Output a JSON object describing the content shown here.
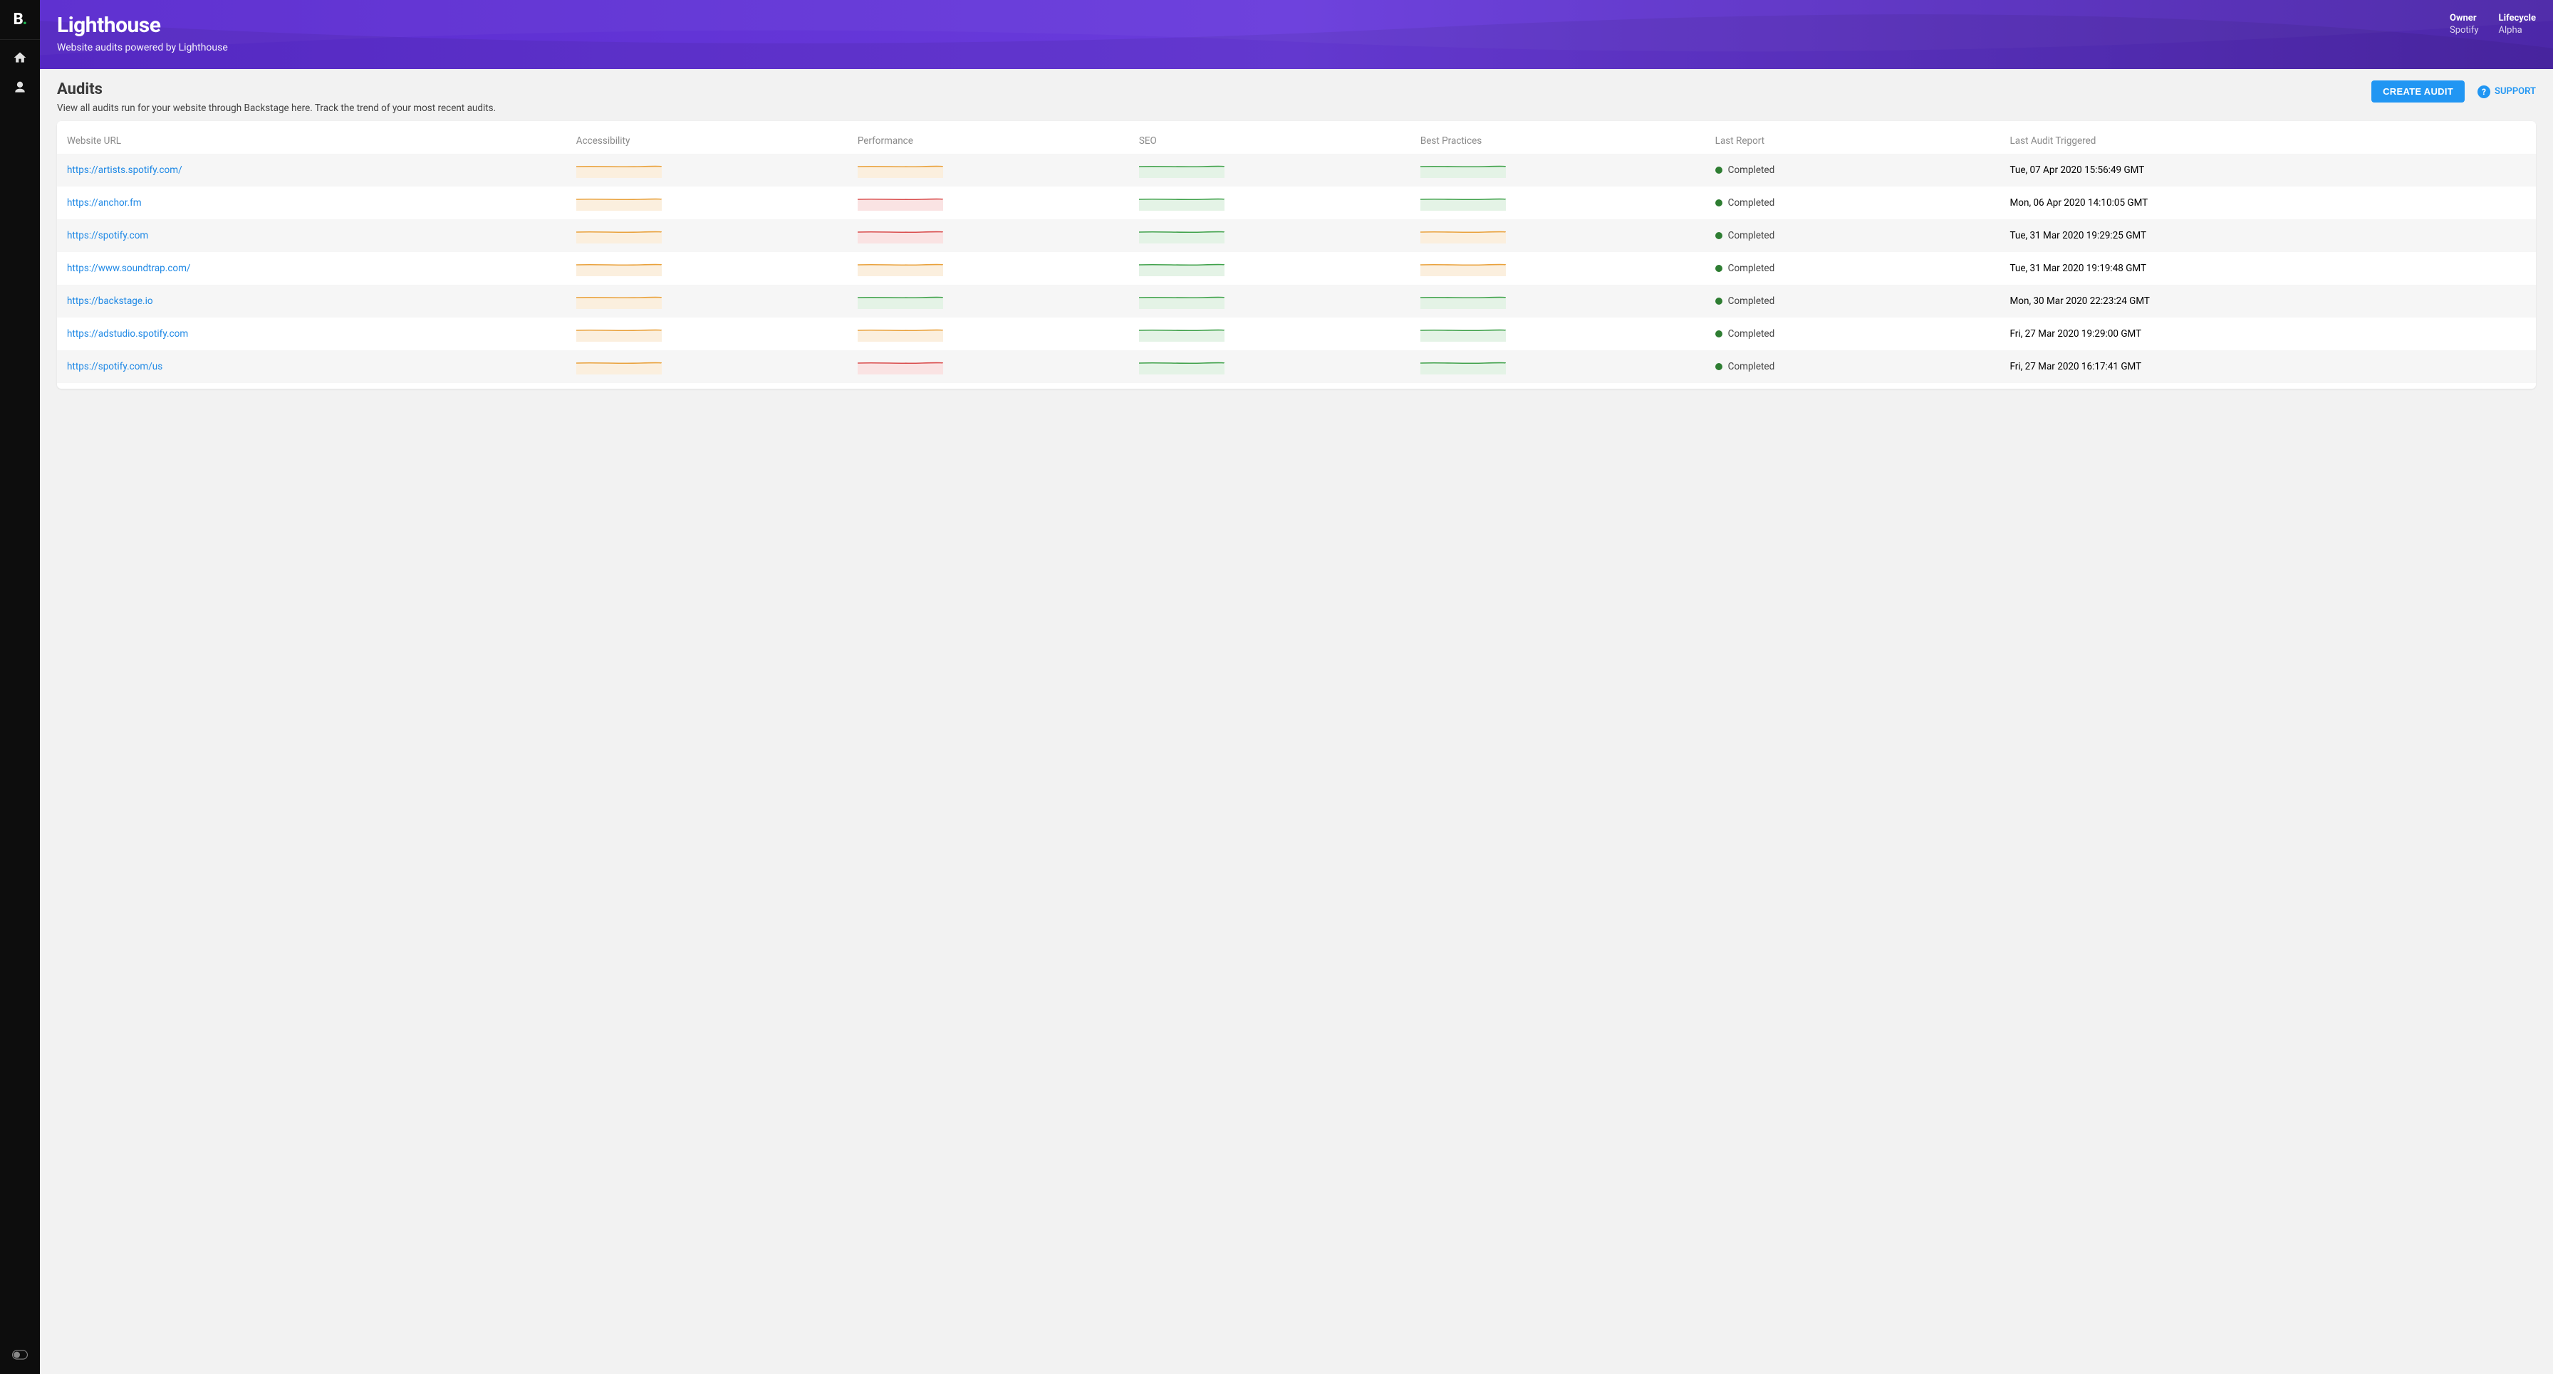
{
  "sidebar": {
    "logo_b": "B",
    "logo_dot": "."
  },
  "header": {
    "title": "Lighthouse",
    "subtitle": "Website audits powered by Lighthouse",
    "meta": [
      {
        "label": "Owner",
        "value": "Spotify"
      },
      {
        "label": "Lifecycle",
        "value": "Alpha"
      }
    ]
  },
  "section": {
    "title": "Audits",
    "description": "View all audits run for your website through Backstage here. Track the trend of your most recent audits.",
    "create_btn": "CREATE AUDIT",
    "support": "SUPPORT"
  },
  "columns": {
    "url": "Website URL",
    "accessibility": "Accessibility",
    "performance": "Performance",
    "seo": "SEO",
    "best_practices": "Best Practices",
    "last_report": "Last Report",
    "last_triggered": "Last Audit Triggered"
  },
  "rows": [
    {
      "url": "https://artists.spotify.com/",
      "acc": "orange",
      "perf": "orange",
      "seo": "green",
      "bp": "green",
      "report": "Completed",
      "triggered": "Tue, 07 Apr 2020 15:56:49 GMT"
    },
    {
      "url": "https://anchor.fm",
      "acc": "orange",
      "perf": "red",
      "seo": "green",
      "bp": "green",
      "report": "Completed",
      "triggered": "Mon, 06 Apr 2020 14:10:05 GMT"
    },
    {
      "url": "https://spotify.com",
      "acc": "orange",
      "perf": "red",
      "seo": "green",
      "bp": "orange",
      "report": "Completed",
      "triggered": "Tue, 31 Mar 2020 19:29:25 GMT"
    },
    {
      "url": "https://www.soundtrap.com/",
      "acc": "orange",
      "perf": "orange",
      "seo": "green",
      "bp": "orange",
      "report": "Completed",
      "triggered": "Tue, 31 Mar 2020 19:19:48 GMT"
    },
    {
      "url": "https://backstage.io",
      "acc": "orange",
      "perf": "green",
      "seo": "green",
      "bp": "green",
      "report": "Completed",
      "triggered": "Mon, 30 Mar 2020 22:23:24 GMT"
    },
    {
      "url": "https://adstudio.spotify.com",
      "acc": "orange",
      "perf": "orange",
      "seo": "green",
      "bp": "green",
      "report": "Completed",
      "triggered": "Fri, 27 Mar 2020 19:29:00 GMT"
    },
    {
      "url": "https://spotify.com/us",
      "acc": "orange",
      "perf": "red",
      "seo": "green",
      "bp": "green",
      "report": "Completed",
      "triggered": "Fri, 27 Mar 2020 16:17:41 GMT"
    }
  ],
  "spark_colors": {
    "green": {
      "stroke": "#3fa14a",
      "fill": "#e4f3e6"
    },
    "orange": {
      "stroke": "#e9a13b",
      "fill": "#fbefde"
    },
    "red": {
      "stroke": "#d94c4c",
      "fill": "#fae3e3"
    }
  }
}
